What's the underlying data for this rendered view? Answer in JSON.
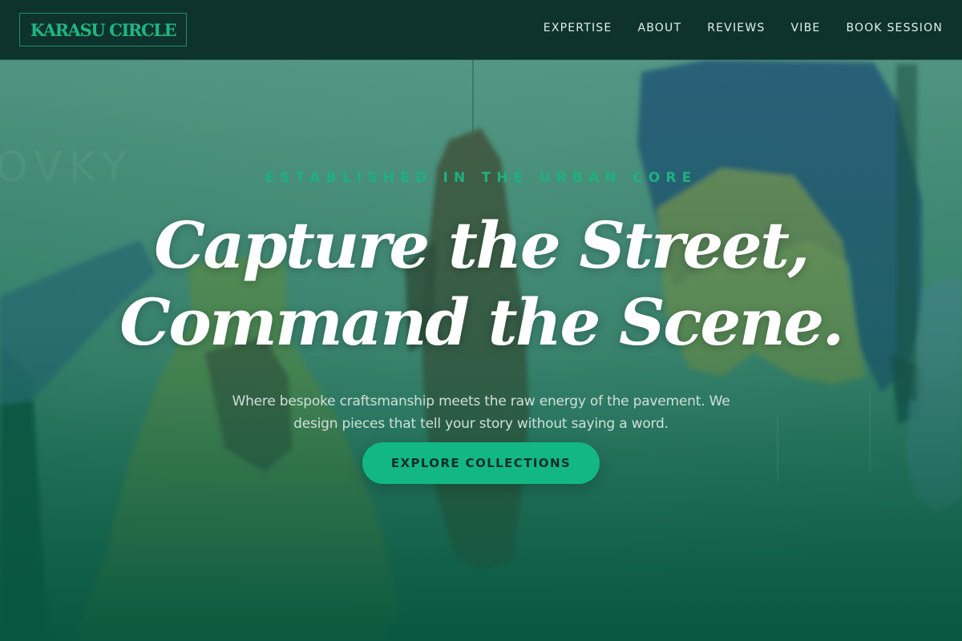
{
  "brand": {
    "name": "KARASU CIRCLE",
    "accent_color": "#1fb07f",
    "overlay_color": "#0d5a46"
  },
  "nav": {
    "links": [
      "EXPERTISE",
      "ABOUT",
      "REVIEWS",
      "VIBE",
      "BOOK SESSION"
    ]
  },
  "hero": {
    "eyebrow": "ESTABLISHED IN THE URBAN CORE",
    "headline_line1": "Capture the Street,",
    "headline_line2": "Command the Scene.",
    "subtitle_line1": "Where bespoke craftsmanship meets the raw energy of the pavement. We",
    "subtitle_line2": "design pieces that tell your story without saying a word.",
    "cta_label": "EXPLORE COLLECTIONS",
    "background_image": "hanging-garments-photo"
  }
}
